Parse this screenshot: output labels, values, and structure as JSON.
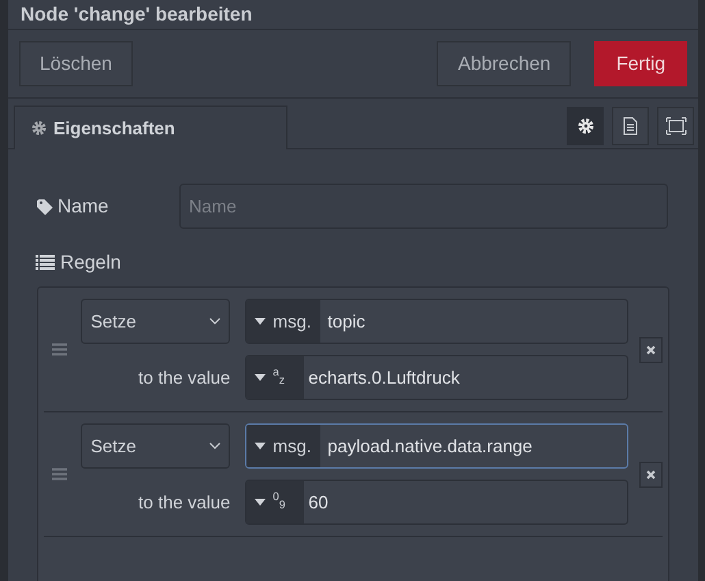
{
  "window": {
    "title": "Node 'change' bearbeiten"
  },
  "buttons": [
    {
      "label": "Löschen",
      "kind": "plain"
    },
    {
      "label": "Abbrechen",
      "kind": "plain"
    },
    {
      "label": "Fertig",
      "kind": "primary"
    }
  ],
  "tabs": [
    {
      "label": "Eigenschaften",
      "selected": true
    }
  ],
  "tab_tools": [
    {
      "kind": "gear",
      "selected": true
    },
    {
      "kind": "doc",
      "selected": false
    },
    {
      "kind": "frame",
      "selected": false
    }
  ],
  "name_field": {
    "label": "Name",
    "placeholder": "Name"
  },
  "rules_label": "Regeln",
  "rules": [
    {
      "action": "Setze",
      "property": {
        "prefix": "msg.",
        "value": "topic",
        "focused": false
      },
      "value_label": "to the value",
      "value": {
        "type_marker": "$^{a}$$_{z}$",
        "value": "echarts.0.Luftdruck"
      }
    },
    {
      "action": "Setze",
      "property": {
        "prefix": "msg.",
        "value": "payload.native.data.range",
        "focused": true
      },
      "value_label": "to the value",
      "value": {
        "type_marker": "$^{0}$$_{9}$",
        "value": "60"
      }
    }
  ]
}
